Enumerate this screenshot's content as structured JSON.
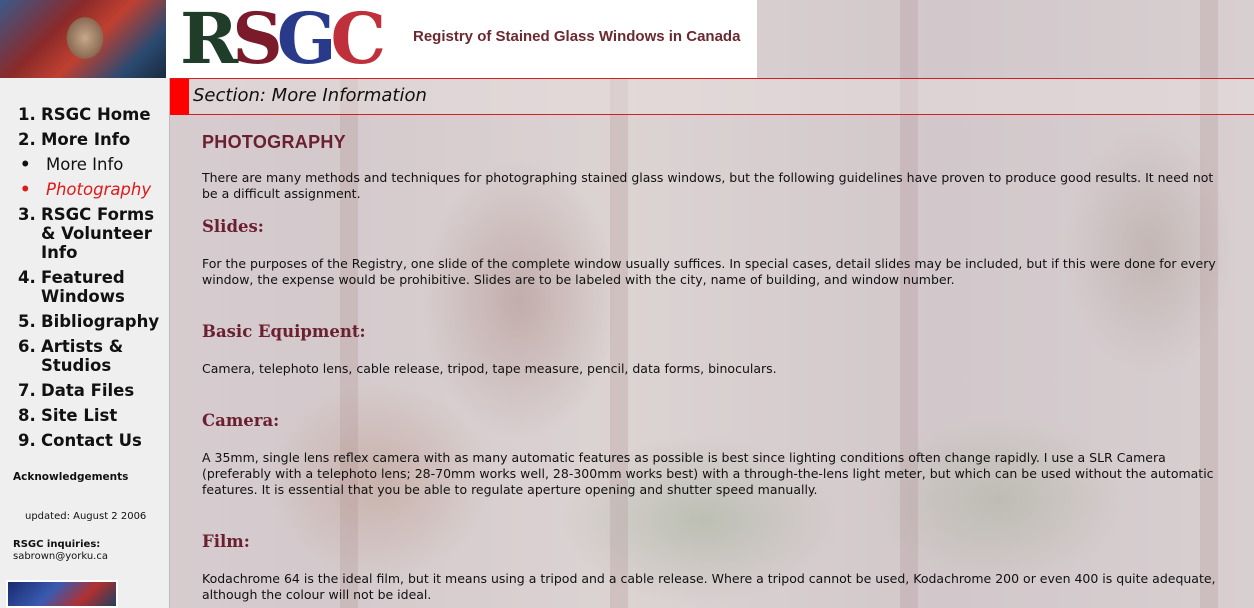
{
  "header": {
    "logo_letters": [
      "R",
      "S",
      "G",
      "C"
    ],
    "logo_colors": [
      "#1f3d28",
      "#7a1a2a",
      "#2a3a8a",
      "#c0303a"
    ],
    "site_title": "Registry of Stained Glass Windows in Canada"
  },
  "section": {
    "title": "Section: More Information",
    "marker_color": "#ff0000"
  },
  "sidebar": {
    "nav": [
      {
        "num": "1.",
        "label": "RSGC Home"
      },
      {
        "num": "2.",
        "label": "More Info"
      }
    ],
    "sub_items": [
      {
        "bullet": "•",
        "label": "More Info"
      },
      {
        "bullet": "•",
        "label": "Photography"
      }
    ],
    "nav_rest": [
      {
        "num": "3.",
        "label": "RSGC Forms & Volunteer Info"
      },
      {
        "num": "4.",
        "label": "Featured Windows"
      },
      {
        "num": "5.",
        "label": "Bibliography"
      },
      {
        "num": "6.",
        "label": "Artists & Studios"
      },
      {
        "num": "7.",
        "label": "Data Files"
      },
      {
        "num": "8.",
        "label": "Site List"
      },
      {
        "num": "9.",
        "label": "Contact Us"
      }
    ],
    "acknowledgements": "Acknowledgements",
    "updated": "updated: August 2 2006",
    "inquiries_label": "RSGC inquiries:",
    "inquiries_email": "sabrown@yorku.ca",
    "current_color": "#e01818"
  },
  "content": {
    "heading": "PHOTOGRAPHY",
    "intro": "There are many methods and techniques for photographing stained glass windows, but the following guidelines have proven to produce good results. It need not be a difficult assignment.",
    "sections": [
      {
        "heading": "Slides:",
        "text": "For the purposes of the Registry, one slide of the complete window usually suffices. In special cases, detail slides may be included, but if this were done for every window, the expense would be prohibitive. Slides are to be labeled with the city, name of building, and window number."
      },
      {
        "heading": "Basic Equipment:",
        "text": "Camera, telephoto lens, cable release, tripod, tape measure, pencil, data forms, binoculars."
      },
      {
        "heading": "Camera:",
        "text": "A 35mm, single lens reflex camera with as many automatic features as possible is best since lighting conditions often change rapidly. I use a SLR Camera (preferably with a telephoto lens; 28-70mm works well, 28-300mm works best) with a through-the-lens light meter, but which can be used without the automatic features. It is essential that you be able to regulate aperture opening and shutter speed manually."
      },
      {
        "heading": "Film:",
        "text": "Kodachrome 64 is the ideal film, but it means using a tripod and a cable release. Where a tripod cannot be used, Kodachrome 200 or even 400 is quite adequate, although the colour will not be ideal."
      }
    ],
    "heading_color": "#6a2030"
  }
}
